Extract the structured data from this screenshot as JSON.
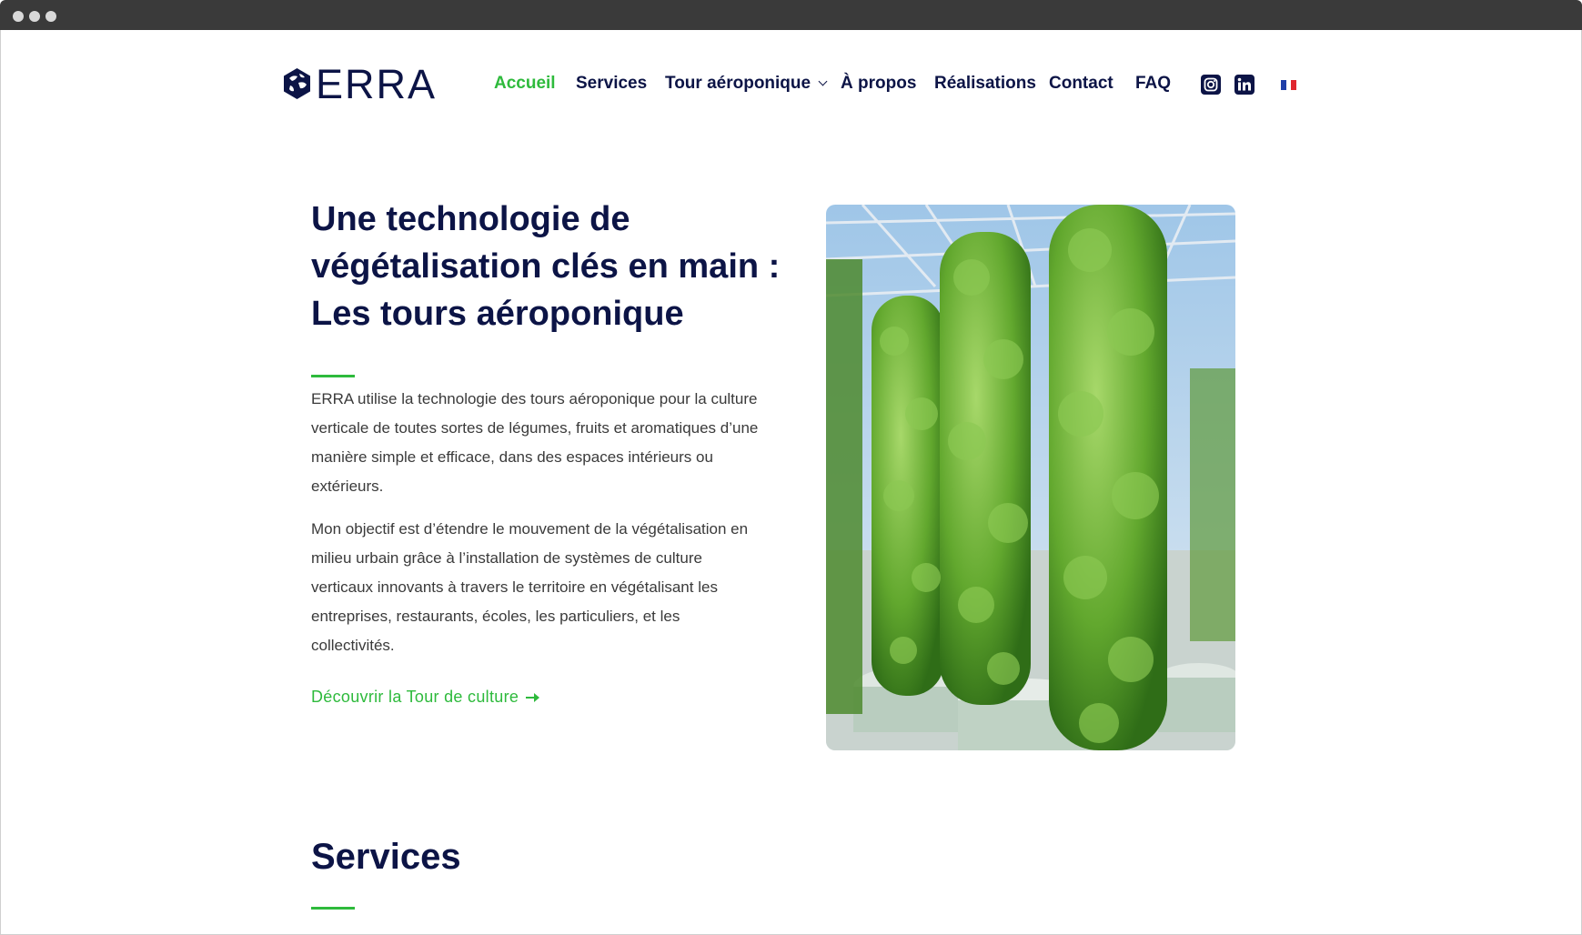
{
  "brand": {
    "name": "ERRA"
  },
  "nav": {
    "items": [
      {
        "label": "Accueil",
        "active": true
      },
      {
        "label": "Services",
        "active": false
      },
      {
        "label": "Tour aéroponique",
        "active": false,
        "has_dropdown": true
      },
      {
        "label": "À propos",
        "active": false
      },
      {
        "label": "Réalisations",
        "active": false
      },
      {
        "label": "Contact",
        "active": false
      },
      {
        "label": "FAQ",
        "active": false
      }
    ],
    "social": [
      "instagram-icon",
      "linkedin-icon"
    ],
    "language_flag": "france-flag-icon"
  },
  "hero": {
    "title": "Une technologie de végétalisation clés en main : Les tours aéroponique",
    "paragraph_1": "ERRA utilise la technologie des tours aéroponique pour la culture verticale de toutes sortes de légumes, fruits et aromatiques d’une manière simple et efficace, dans des espaces intérieurs ou extérieurs.",
    "paragraph_2": "Mon objectif est d’étendre le mouvement de la végétalisation en milieu urbain grâce à l’installation de systèmes de culture verticaux innovants à travers le territoire en végétalisant  les entreprises, restaurants, écoles, les particuliers, et les collectivités.",
    "cta_label": "Découvrir la Tour de culture"
  },
  "services": {
    "title": "Services"
  },
  "colors": {
    "navy": "#0c1446",
    "accent": "#2eba3c",
    "body_text": "#3a3a3a"
  }
}
